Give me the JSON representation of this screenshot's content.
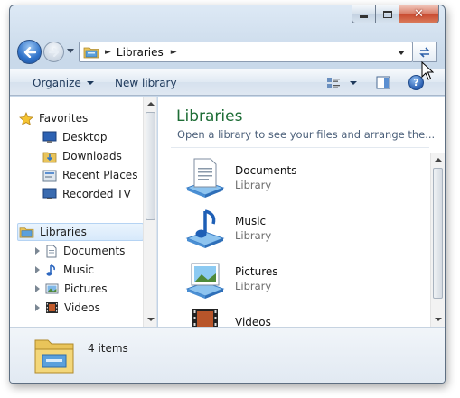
{
  "window": {
    "caption_buttons": {
      "minimize_icon": "minimize-icon",
      "maximize_icon": "maximize-icon",
      "close_glyph": "✕"
    }
  },
  "address": {
    "path": [
      "Libraries"
    ],
    "separator": "►"
  },
  "toolbar": {
    "organize": "Organize",
    "new_library": "New library",
    "help_glyph": "?"
  },
  "nav": {
    "favorites": {
      "label": "Favorites",
      "items": [
        "Desktop",
        "Downloads",
        "Recent Places",
        "Recorded TV"
      ]
    },
    "libraries": {
      "label": "Libraries",
      "items": [
        "Documents",
        "Music",
        "Pictures",
        "Videos"
      ]
    }
  },
  "main": {
    "title": "Libraries",
    "subtitle": "Open a library to see your files and arrange the...",
    "items": [
      {
        "name": "Documents",
        "type": "Library"
      },
      {
        "name": "Music",
        "type": "Library"
      },
      {
        "name": "Pictures",
        "type": "Library"
      },
      {
        "name": "Videos",
        "type": ""
      }
    ]
  },
  "details": {
    "count": "4 items"
  },
  "colors": {
    "title_green": "#1e6d36",
    "toolbar_text": "#1e395b",
    "selection": "#d7e9fb"
  }
}
